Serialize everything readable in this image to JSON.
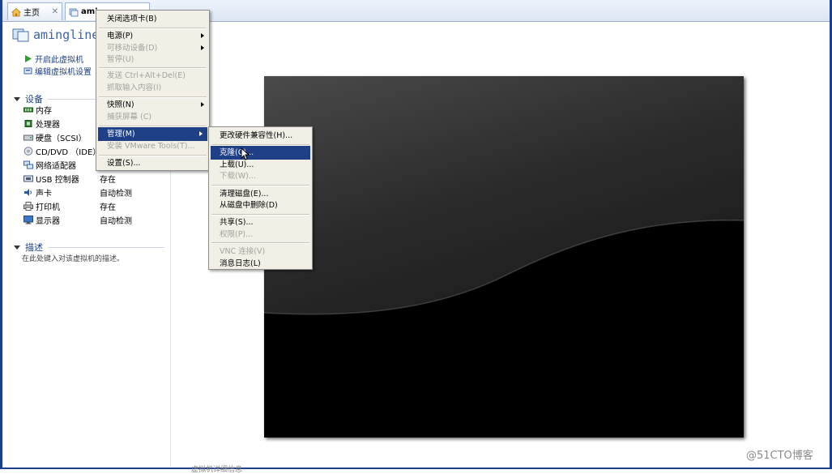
{
  "tabs": [
    {
      "label": "主页"
    },
    {
      "label": "ami"
    }
  ],
  "vm": {
    "title": "amingline",
    "actions": [
      "开启此虚拟机",
      "编辑虚拟机设置"
    ]
  },
  "devices_section": {
    "title": "设备",
    "devices": [
      {
        "name": "内存",
        "value": "",
        "icon": "memory-icon"
      },
      {
        "name": "处理器",
        "value": "",
        "icon": "cpu-icon"
      },
      {
        "name": "硬盘（SCSI）",
        "value": "",
        "icon": "harddisk-icon"
      },
      {
        "name": "CD/DVD （IDE）",
        "value": "",
        "icon": "cdrom-icon"
      },
      {
        "name": "网络适配器",
        "value": "",
        "icon": "network-icon"
      },
      {
        "name": "USB 控制器",
        "value": "存在",
        "icon": "usb-icon"
      },
      {
        "name": "声卡",
        "value": "自动检测",
        "icon": "sound-icon"
      },
      {
        "name": "打印机",
        "value": "存在",
        "icon": "printer-icon"
      },
      {
        "name": "显示器",
        "value": "自动检测",
        "icon": "display-icon"
      }
    ]
  },
  "description_section": {
    "title": "描述",
    "placeholder": "在此处键入对该虚拟机的描述。"
  },
  "context_menu": {
    "items": [
      {
        "label": "关闭选项卡(B)",
        "disabled": false
      },
      {
        "label": "电源(P)",
        "disabled": false,
        "submenu": true
      },
      {
        "label": "可移动设备(D)",
        "disabled": true,
        "submenu": true
      },
      {
        "label": "暂停(U)",
        "disabled": true
      },
      {
        "label": "发送 Ctrl+Alt+Del(E)",
        "disabled": true
      },
      {
        "label": "抓取输入内容(I)",
        "disabled": true
      },
      {
        "label": "快照(N)",
        "disabled": false,
        "submenu": true
      },
      {
        "label": "捕获屏幕 (C)",
        "disabled": true
      },
      {
        "label": "管理(M)",
        "disabled": false,
        "submenu": true,
        "highlighted": true
      },
      {
        "label": "安装 VMware Tools(T)...",
        "disabled": true
      },
      {
        "label": "设置(S)...",
        "disabled": false
      }
    ]
  },
  "manage_submenu": {
    "items": [
      {
        "label": "更改硬件兼容性(H)...",
        "disabled": false
      },
      {
        "label": "克隆(C)...",
        "disabled": false,
        "highlighted": true
      },
      {
        "label": "上载(U)...",
        "disabled": false
      },
      {
        "label": "下载(W)...",
        "disabled": true
      },
      {
        "label": "清理磁盘(E)...",
        "disabled": false
      },
      {
        "label": "从磁盘中删除(D)",
        "disabled": false
      },
      {
        "label": "共享(S)...",
        "disabled": false
      },
      {
        "label": "权限(P)...",
        "disabled": true
      },
      {
        "label": "VNC 连接(V)",
        "disabled": true
      },
      {
        "label": "消息日志(L)",
        "disabled": false
      }
    ]
  },
  "footer": {
    "text": "虚拟机详细信息"
  },
  "watermark": "@51CTO博客",
  "colors": {
    "menu_highlight": "#1f3f87",
    "menu_background": "#f1efe6",
    "link_text": "#1d3f86"
  }
}
